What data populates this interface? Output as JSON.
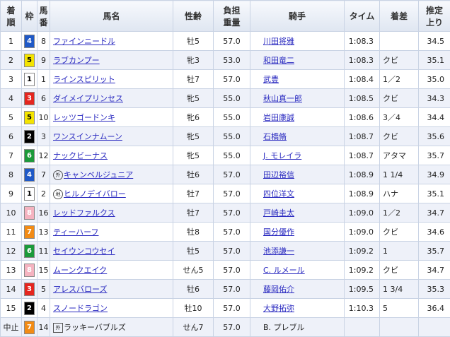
{
  "headers": {
    "rank": [
      "着",
      "順"
    ],
    "waku": "枠",
    "umaban": [
      "馬",
      "番"
    ],
    "horse": "馬名",
    "sexage": "性齢",
    "weight": [
      "負担",
      "重量"
    ],
    "jockey": "騎手",
    "time": "タイム",
    "margin": "着差",
    "last3f": [
      "推定",
      "上り"
    ]
  },
  "colors": {
    "w1": "#ffffff",
    "w2": "#000000",
    "w3": "#e5261f",
    "w4": "#1f59c7",
    "w5": "#f4e400",
    "w6": "#1b9a3a",
    "w7": "#f28b15",
    "w8": "#f5b3c0",
    "link": "#2a2ac0",
    "header_bg": "#dfe6f1",
    "row_alt": "#eef1f9"
  },
  "rows": [
    {
      "rank": "1",
      "waku": "4",
      "umaban": "8",
      "badge": "",
      "horse": "ファインニードル",
      "sexage": "牡5",
      "weight": "57.0",
      "jockey": "川田将雅",
      "time": "1:08.3",
      "margin": "",
      "last3f": "34.5"
    },
    {
      "rank": "2",
      "waku": "5",
      "umaban": "9",
      "badge": "",
      "horse": "ラブカンプー",
      "sexage": "牝3",
      "weight": "53.0",
      "jockey": "和田竜二",
      "time": "1:08.3",
      "margin": "クビ",
      "last3f": "35.1"
    },
    {
      "rank": "3",
      "waku": "1",
      "umaban": "1",
      "badge": "",
      "horse": "ラインスピリット",
      "sexage": "牡7",
      "weight": "57.0",
      "jockey": "武豊",
      "time": "1:08.4",
      "margin": "1／2",
      "last3f": "35.0"
    },
    {
      "rank": "4",
      "waku": "3",
      "umaban": "6",
      "badge": "",
      "horse": "ダイメイプリンセス",
      "sexage": "牝5",
      "weight": "55.0",
      "jockey": "秋山真一郎",
      "time": "1:08.5",
      "margin": "クビ",
      "last3f": "34.3"
    },
    {
      "rank": "5",
      "waku": "5",
      "umaban": "10",
      "badge": "",
      "horse": "レッツゴードンキ",
      "sexage": "牝6",
      "weight": "55.0",
      "jockey": "岩田康誠",
      "time": "1:08.6",
      "margin": "3／4",
      "last3f": "34.4"
    },
    {
      "rank": "6",
      "waku": "2",
      "umaban": "3",
      "badge": "",
      "horse": "ワンスインナムーン",
      "sexage": "牝5",
      "weight": "55.0",
      "jockey": "石橋脩",
      "time": "1:08.7",
      "margin": "クビ",
      "last3f": "35.6"
    },
    {
      "rank": "7",
      "waku": "6",
      "umaban": "12",
      "badge": "",
      "horse": "ナックビーナス",
      "sexage": "牝5",
      "weight": "55.0",
      "jockey": "J. モレイラ",
      "time": "1:08.7",
      "margin": "アタマ",
      "last3f": "35.7"
    },
    {
      "rank": "8",
      "waku": "4",
      "umaban": "7",
      "badge": "外",
      "horse": "キャンベルジュニア",
      "sexage": "牡6",
      "weight": "57.0",
      "jockey": "田辺裕信",
      "time": "1:08.9",
      "margin": "1 1/4",
      "last3f": "34.9"
    },
    {
      "rank": "9",
      "waku": "1",
      "umaban": "2",
      "badge": "地",
      "horse": "ヒルノデイバロー",
      "sexage": "牡7",
      "weight": "57.0",
      "jockey": "四位洋文",
      "time": "1:08.9",
      "margin": "ハナ",
      "last3f": "35.1"
    },
    {
      "rank": "10",
      "waku": "8",
      "umaban": "16",
      "badge": "",
      "horse": "レッドファルクス",
      "sexage": "牡7",
      "weight": "57.0",
      "jockey": "戸崎圭太",
      "time": "1:09.0",
      "margin": "1／2",
      "last3f": "34.7"
    },
    {
      "rank": "11",
      "waku": "7",
      "umaban": "13",
      "badge": "",
      "horse": "ティーハーフ",
      "sexage": "牡8",
      "weight": "57.0",
      "jockey": "国分優作",
      "time": "1:09.0",
      "margin": "クビ",
      "last3f": "34.6"
    },
    {
      "rank": "12",
      "waku": "6",
      "umaban": "11",
      "badge": "",
      "horse": "セイウンコウセイ",
      "sexage": "牡5",
      "weight": "57.0",
      "jockey": "池添謙一",
      "time": "1:09.2",
      "margin": "1",
      "last3f": "35.7"
    },
    {
      "rank": "13",
      "waku": "8",
      "umaban": "15",
      "badge": "",
      "horse": "ムーンクエイク",
      "sexage": "せん5",
      "weight": "57.0",
      "jockey": "C. ルメール",
      "time": "1:09.2",
      "margin": "クビ",
      "last3f": "34.7"
    },
    {
      "rank": "14",
      "waku": "3",
      "umaban": "5",
      "badge": "",
      "horse": "アレスバローズ",
      "sexage": "牡6",
      "weight": "57.0",
      "jockey": "藤岡佑介",
      "time": "1:09.5",
      "margin": "1 3/4",
      "last3f": "35.3"
    },
    {
      "rank": "15",
      "waku": "2",
      "umaban": "4",
      "badge": "",
      "horse": "スノードラゴン",
      "sexage": "牡10",
      "weight": "57.0",
      "jockey": "大野拓弥",
      "time": "1:10.3",
      "margin": "5",
      "last3f": "36.4"
    },
    {
      "rank": "中止",
      "waku": "7",
      "umaban": "14",
      "badge": "外",
      "badgeSquare": true,
      "horse": "ラッキーバブルズ",
      "sexage": "せん7",
      "weight": "57.0",
      "jockey": "B. プレブル",
      "time": "",
      "margin": "",
      "last3f": ""
    }
  ]
}
